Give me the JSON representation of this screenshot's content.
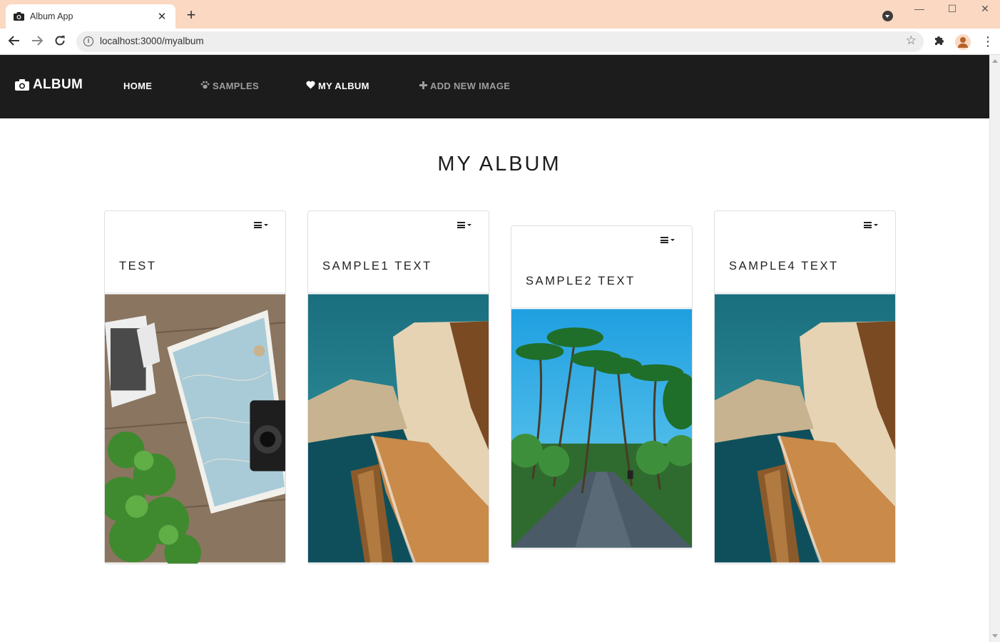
{
  "browser": {
    "tab_title": "Album App",
    "tab_close": "✕",
    "new_tab": "+",
    "url": "localhost:3000/myalbum",
    "window_controls": {
      "minimize": "—",
      "maximize": "☐",
      "close": "✕"
    },
    "icons": {
      "favicon": "camera-icon",
      "back": "back-arrow-icon",
      "forward": "forward-arrow-icon",
      "reload": "reload-icon",
      "info": "info-icon",
      "bookmark": "star-icon",
      "extensions": "puzzle-icon",
      "profile": "profile-avatar-icon",
      "menu": "kebab-menu-icon"
    }
  },
  "navbar": {
    "brand": "ALBUM",
    "brand_icon": "camera-icon",
    "links": [
      {
        "label": "HOME",
        "icon": "",
        "active": true
      },
      {
        "label": "SAMPLES",
        "icon": "paw-icon",
        "active": false
      },
      {
        "label": "MY ALBUM",
        "icon": "heart-icon",
        "active": true
      },
      {
        "label": "ADD NEW IMAGE",
        "icon": "plus-icon",
        "active": false
      }
    ],
    "colors": {
      "background": "#1c1c1c",
      "active_text": "#ffffff",
      "muted_text": "#9d9d9d"
    }
  },
  "page": {
    "title": "MY ALBUM"
  },
  "cards": [
    {
      "title": "TEST",
      "image": "travel-photos-map-camera-plant",
      "menu_icon": "hamburger-dropdown-icon"
    },
    {
      "title": "SAMPLE1 TEXT",
      "image": "coastal-cliffs-beach",
      "menu_icon": "hamburger-dropdown-icon"
    },
    {
      "title": "SAMPLE2 TEXT",
      "image": "palm-trees-road",
      "menu_icon": "hamburger-dropdown-icon"
    },
    {
      "title": "SAMPLE4 TEXT",
      "image": "coastal-cliffs-beach",
      "menu_icon": "hamburger-dropdown-icon"
    }
  ]
}
